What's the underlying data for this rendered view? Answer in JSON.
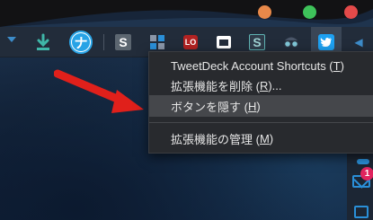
{
  "window": {
    "controls": [
      "minimize",
      "maximize",
      "close"
    ]
  },
  "toolbar": {
    "extensions": [
      {
        "name": "download",
        "icon": "download-icon"
      },
      {
        "name": "nav",
        "icon": "nav-icon",
        "glyph": "ナ"
      },
      {
        "name": "s-extension",
        "icon": "s-icon",
        "glyph": "S"
      },
      {
        "name": "grid",
        "icon": "grid-icon"
      },
      {
        "name": "lo",
        "icon": "lo-icon",
        "glyph": "LO"
      },
      {
        "name": "window",
        "icon": "window-icon"
      },
      {
        "name": "s-extension-2",
        "icon": "s-bracket-icon",
        "glyph": "S"
      },
      {
        "name": "spy",
        "icon": "spy-icon"
      },
      {
        "name": "tweetdeck",
        "icon": "twitter-icon"
      }
    ]
  },
  "context_menu": {
    "items": [
      {
        "label": "TweetDeck Account Shortcuts (",
        "key": "T",
        "suffix": ")"
      },
      {
        "label": "拡張機能を削除 (",
        "key": "R",
        "suffix": ")..."
      },
      {
        "label": "ボタンを隠す (",
        "key": "H",
        "suffix": ")"
      },
      {
        "label": "拡張機能の管理 (",
        "key": "M",
        "suffix": ")"
      }
    ]
  },
  "notifications": {
    "badge_count": "1"
  },
  "colors": {
    "accent": "#2a8fd8",
    "arrow": "#e0201b",
    "menu_bg": "#282a2e",
    "menu_hover": "#45474b"
  }
}
